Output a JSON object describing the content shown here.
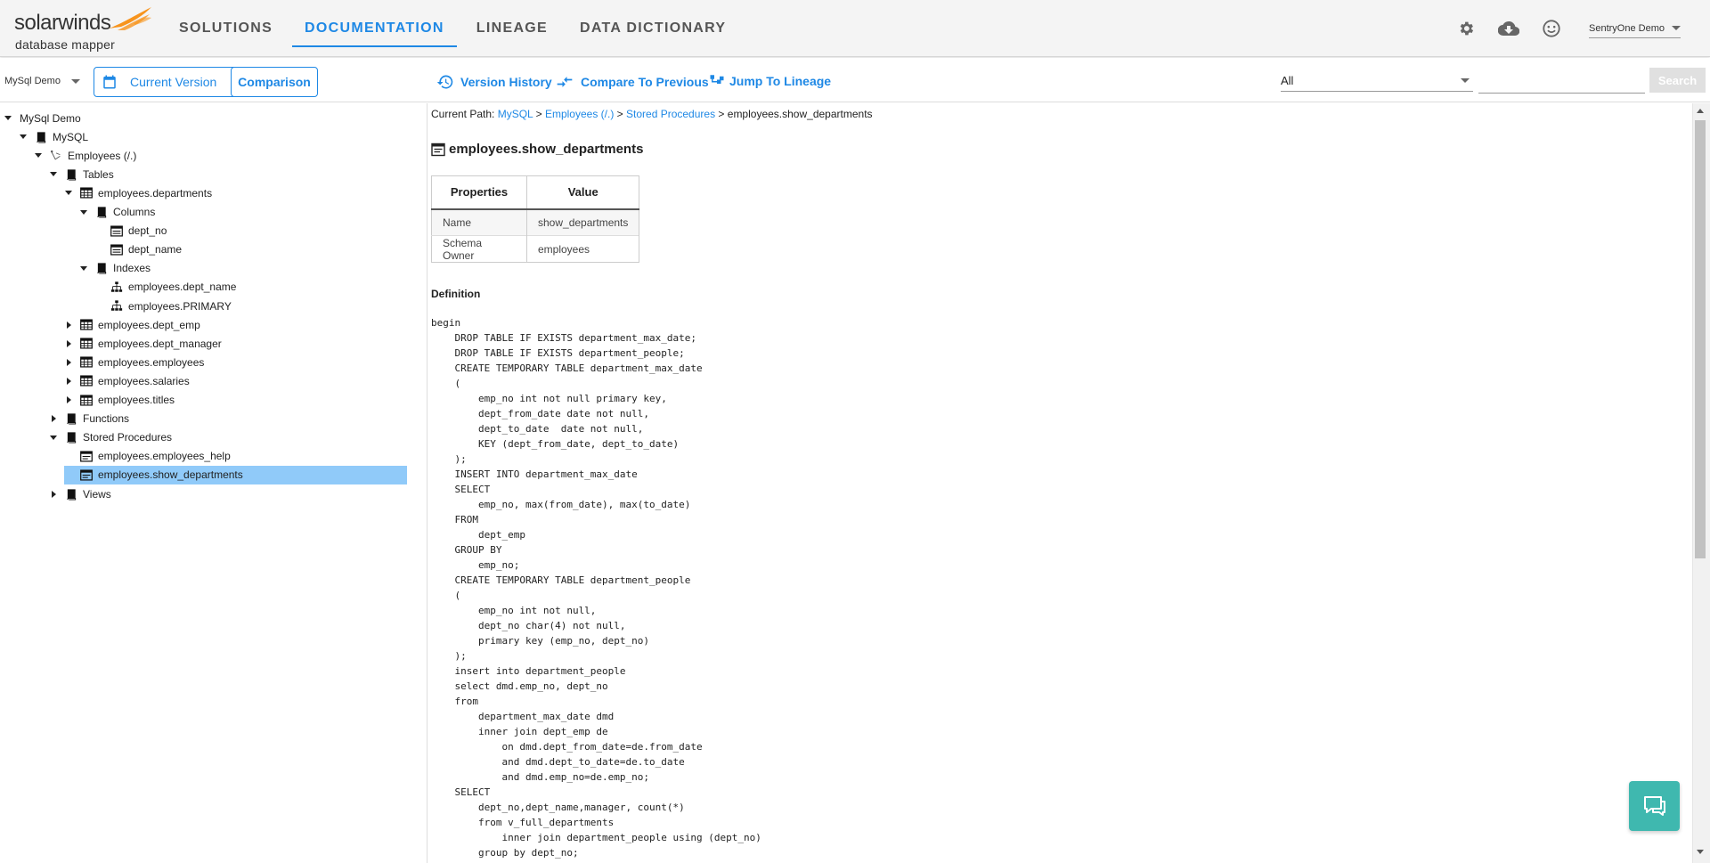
{
  "brand": {
    "logo_top": "solarwinds",
    "logo_bottom": "database mapper",
    "accent": "#1e88e5",
    "flame_color": "#f7941d"
  },
  "nav": {
    "items": [
      {
        "label": "SOLUTIONS",
        "active": false
      },
      {
        "label": "DOCUMENTATION",
        "active": true
      },
      {
        "label": "LINEAGE",
        "active": false
      },
      {
        "label": "DATA DICTIONARY",
        "active": false
      }
    ],
    "icons": [
      "gear-icon",
      "cloud-download-icon",
      "smiley-icon"
    ],
    "user": "SentryOne Demo"
  },
  "toolbar": {
    "db_select": "MySql Demo",
    "current_version": "Current Version",
    "comparison": "Comparison",
    "version_history": "Version History",
    "compare_previous": "Compare To Previous",
    "jump_lineage": "Jump To Lineage",
    "filter_value": "All",
    "search_placeholder": "",
    "search_button": "Search"
  },
  "tree": [
    {
      "label": "MySql Demo",
      "toggle": "down",
      "icon": "none",
      "level": 0
    },
    {
      "label": "MySQL",
      "toggle": "down",
      "icon": "book",
      "level": 1
    },
    {
      "label": "Employees (/.)",
      "toggle": "down",
      "icon": "database",
      "level": 2
    },
    {
      "label": "Tables",
      "toggle": "down",
      "icon": "book",
      "level": 3
    },
    {
      "label": "employees.departments",
      "toggle": "down",
      "icon": "table",
      "level": 4
    },
    {
      "label": "Columns",
      "toggle": "down",
      "icon": "book",
      "level": 5
    },
    {
      "label": "dept_no",
      "toggle": "none",
      "icon": "column",
      "level": 6
    },
    {
      "label": "dept_name",
      "toggle": "none",
      "icon": "column",
      "level": 6
    },
    {
      "label": "Indexes",
      "toggle": "down",
      "icon": "book",
      "level": 5
    },
    {
      "label": "employees.dept_name",
      "toggle": "none",
      "icon": "index",
      "level": 6
    },
    {
      "label": "employees.PRIMARY",
      "toggle": "none",
      "icon": "index",
      "level": 6
    },
    {
      "label": "employees.dept_emp",
      "toggle": "right",
      "icon": "table",
      "level": 4
    },
    {
      "label": "employees.dept_manager",
      "toggle": "right",
      "icon": "table",
      "level": 4
    },
    {
      "label": "employees.employees",
      "toggle": "right",
      "icon": "table",
      "level": 4
    },
    {
      "label": "employees.salaries",
      "toggle": "right",
      "icon": "table",
      "level": 4
    },
    {
      "label": "employees.titles",
      "toggle": "right",
      "icon": "table",
      "level": 4
    },
    {
      "label": "Functions",
      "toggle": "right",
      "icon": "book",
      "level": 3
    },
    {
      "label": "Stored Procedures",
      "toggle": "down",
      "icon": "book",
      "level": 3
    },
    {
      "label": "employees.employees_help",
      "toggle": "none",
      "icon": "proc",
      "level": 4
    },
    {
      "label": "employees.show_departments",
      "toggle": "none",
      "icon": "proc",
      "level": 4,
      "selected": true
    },
    {
      "label": "Views",
      "toggle": "right",
      "icon": "book",
      "level": 3
    }
  ],
  "content": {
    "path_label": "Current Path:",
    "crumbs": [
      "MySQL",
      "Employees (/.)",
      "Stored Procedures"
    ],
    "crumb_current": "employees.show_departments",
    "title": "employees.show_departments",
    "props_header": [
      "Properties",
      "Value"
    ],
    "props": [
      {
        "key": "Name",
        "value": "show_departments"
      },
      {
        "key": "Schema Owner",
        "value": "employees"
      }
    ],
    "definition_label": "Definition",
    "code": "begin\n    DROP TABLE IF EXISTS department_max_date;\n    DROP TABLE IF EXISTS department_people;\n    CREATE TEMPORARY TABLE department_max_date\n    (\n        emp_no int not null primary key,\n        dept_from_date date not null,\n        dept_to_date  date not null,\n        KEY (dept_from_date, dept_to_date)\n    );\n    INSERT INTO department_max_date\n    SELECT\n        emp_no, max(from_date), max(to_date)\n    FROM\n        dept_emp\n    GROUP BY\n        emp_no;\n    CREATE TEMPORARY TABLE department_people\n    (\n        emp_no int not null,\n        dept_no char(4) not null,\n        primary key (emp_no, dept_no)\n    );\n    insert into department_people\n    select dmd.emp_no, dept_no\n    from\n        department_max_date dmd\n        inner join dept_emp de\n            on dmd.dept_from_date=de.from_date\n            and dmd.dept_to_date=de.to_date\n            and dmd.emp_no=de.emp_no;\n    SELECT\n        dept_no,dept_name,manager, count(*)\n        from v_full_departments\n            inner join department_people using (dept_no)\n        group by dept_no;"
  }
}
